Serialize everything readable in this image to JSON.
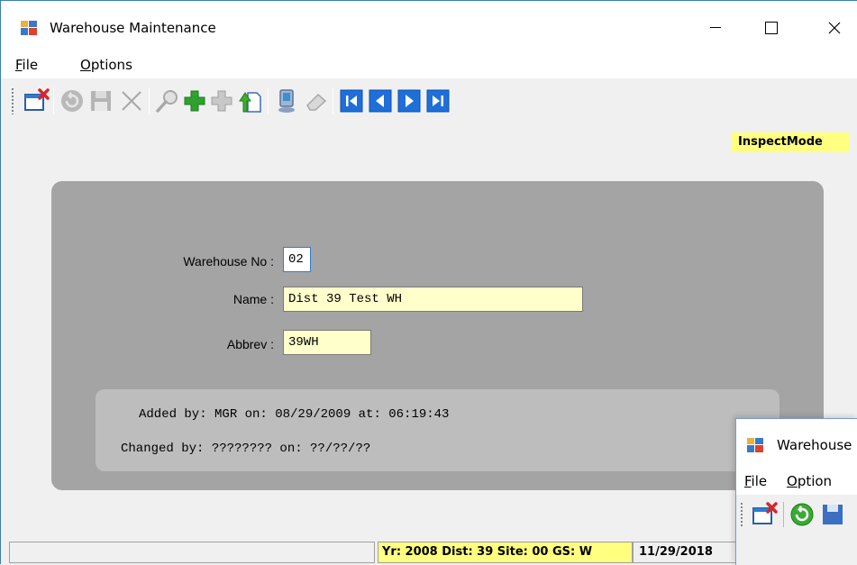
{
  "window": {
    "title": "Warehouse Maintenance",
    "controls": {
      "minimize": "—",
      "maximize": "☐",
      "close": "✕"
    }
  },
  "menu": {
    "items": [
      {
        "label": "File",
        "mnemonic": "F",
        "rest": "ile"
      },
      {
        "label": "Options",
        "mnemonic": "O",
        "rest": "ptions"
      }
    ]
  },
  "toolbar": {
    "buttons": [
      {
        "name": "exit-icon",
        "enabled": true
      },
      {
        "name": "undo-icon",
        "enabled": false
      },
      {
        "name": "save-icon",
        "enabled": false
      },
      {
        "name": "delete-icon",
        "enabled": false
      },
      {
        "name": "search-icon",
        "enabled": false
      },
      {
        "name": "add-icon",
        "enabled": true
      },
      {
        "name": "copy-add-icon",
        "enabled": false
      },
      {
        "name": "export-icon",
        "enabled": true
      },
      {
        "name": "computer-icon",
        "enabled": true
      },
      {
        "name": "eraser-icon",
        "enabled": false
      },
      {
        "name": "first-record-icon",
        "enabled": true
      },
      {
        "name": "previous-record-icon",
        "enabled": true
      },
      {
        "name": "next-record-icon",
        "enabled": true
      },
      {
        "name": "last-record-icon",
        "enabled": true
      }
    ]
  },
  "mode_badge": "InspectMode",
  "form": {
    "warehouse_no": {
      "label": "Warehouse No :",
      "value": "02"
    },
    "name": {
      "label": "Name :",
      "value": "Dist 39 Test WH"
    },
    "abbrev": {
      "label": "Abbrev :",
      "value": "39WH"
    }
  },
  "audit": {
    "added": "Added by: MGR on: 08/29/2009 at: 06:19:43",
    "changed": "Changed by: ???????? on: ??/??/??"
  },
  "status": {
    "left": "",
    "context": "Yr: 2008 Dist: 39 Site: 00 GS: W",
    "date": "11/29/2018"
  },
  "second_window": {
    "title": "Warehouse",
    "menu": [
      {
        "label": "File",
        "mnemonic": "F",
        "rest": "ile"
      },
      {
        "label": "Option",
        "mnemonic": "O",
        "rest": "ption"
      }
    ]
  },
  "colors": {
    "highlight_yellow": "#ffff80",
    "field_yellow": "#ffffcc",
    "panel_gray": "#a4a4a4",
    "audit_gray": "#bdbdbd",
    "nav_blue": "#1e6fd9"
  }
}
